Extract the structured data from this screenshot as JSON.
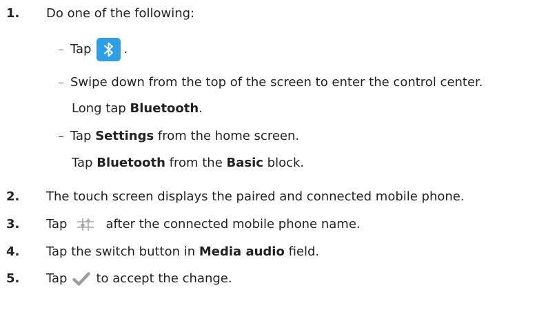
{
  "steps": [
    {
      "num": "1.",
      "text": "Do one of the following:"
    },
    {
      "num": "2.",
      "text": "The touch screen displays the paired and connected mobile phone."
    },
    {
      "num": "3.",
      "text_a": "Tap",
      "text_b": "after the connected mobile phone name."
    },
    {
      "num": "4.",
      "text_a": "Tap the switch button in",
      "bold": "Media audio",
      "text_b": "field."
    },
    {
      "num": "5.",
      "text_a": "Tap",
      "text_b": "to accept the change."
    }
  ],
  "options": {
    "opt1": {
      "text_a": "Tap",
      "text_b": "."
    },
    "opt2": {
      "text": "Swipe down from the top of the screen to enter the control center."
    },
    "opt2_cont": {
      "text_a": "Long tap",
      "bold": "Bluetooth",
      "text_b": "."
    },
    "opt3": {
      "text_a": "Tap",
      "bold": "Settings",
      "text_b": "from the home screen."
    },
    "opt3_cont": {
      "text_a": "Tap",
      "bold_a": "Bluetooth",
      "text_b": "from the",
      "bold_b": "Basic",
      "text_c": "block."
    }
  },
  "icons": {
    "bluetooth": "bluetooth-icon",
    "settings": "settings-sliders-icon",
    "check": "checkmark-icon"
  },
  "colors": {
    "bluetooth_bg": "#2e9ee6",
    "icon_gray": "#a7a7a7",
    "check_gray": "#9e9e9e"
  }
}
